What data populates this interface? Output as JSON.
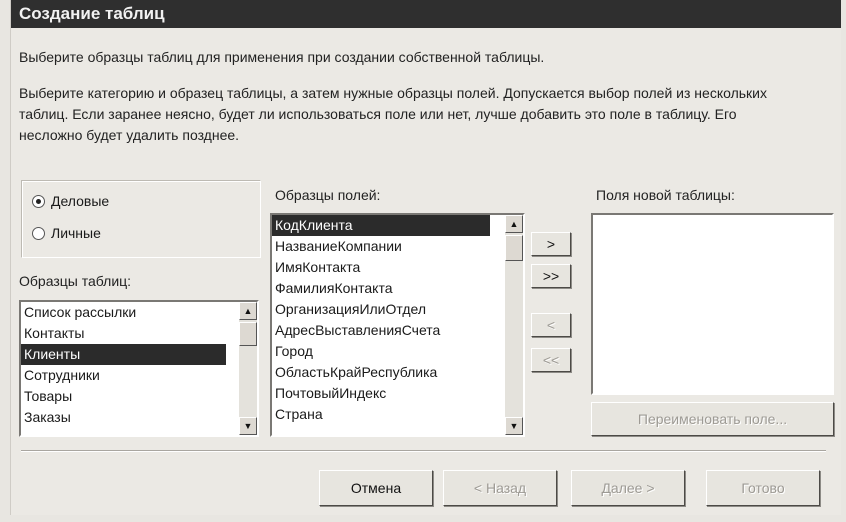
{
  "window": {
    "title": "Создание таблиц"
  },
  "intro": {
    "line1": "Выберите образцы таблиц для применения при создании собственной таблицы.",
    "line2": "Выберите категорию и образец таблицы, а затем нужные образцы полей. Допускается выбор полей из нескольких таблиц. Если заранее неясно, будет ли использоваться поле или нет, лучше добавить это поле в таблицу. Его несложно будет удалить позднее."
  },
  "category": {
    "options": [
      {
        "label": "Деловые",
        "checked": true
      },
      {
        "label": "Личные",
        "checked": false
      }
    ]
  },
  "sample_tables": {
    "label": "Образцы таблиц:",
    "items": [
      "Список рассылки",
      "Контакты",
      "Клиенты",
      "Сотрудники",
      "Товары",
      "Заказы"
    ],
    "selected": "Клиенты"
  },
  "sample_fields": {
    "label": "Образцы полей:",
    "items": [
      "КодКлиента",
      "НазваниеКомпании",
      "ИмяКонтакта",
      "ФамилияКонтакта",
      "ОрганизацияИлиОтдел",
      "АдресВыставленияСчета",
      "Город",
      "ОбластьКрайРеспублика",
      "ПочтовыйИндекс",
      "Страна"
    ],
    "selected": "КодКлиента"
  },
  "new_fields": {
    "label": "Поля новой таблицы:",
    "items": []
  },
  "move_buttons": {
    "add_one": ">",
    "add_all": ">>",
    "remove_one": "<",
    "remove_all": "<<"
  },
  "rename_button": "Переименовать поле...",
  "footer": {
    "cancel": "Отмена",
    "back": "< Назад",
    "next": "Далее >",
    "finish": "Готово"
  }
}
